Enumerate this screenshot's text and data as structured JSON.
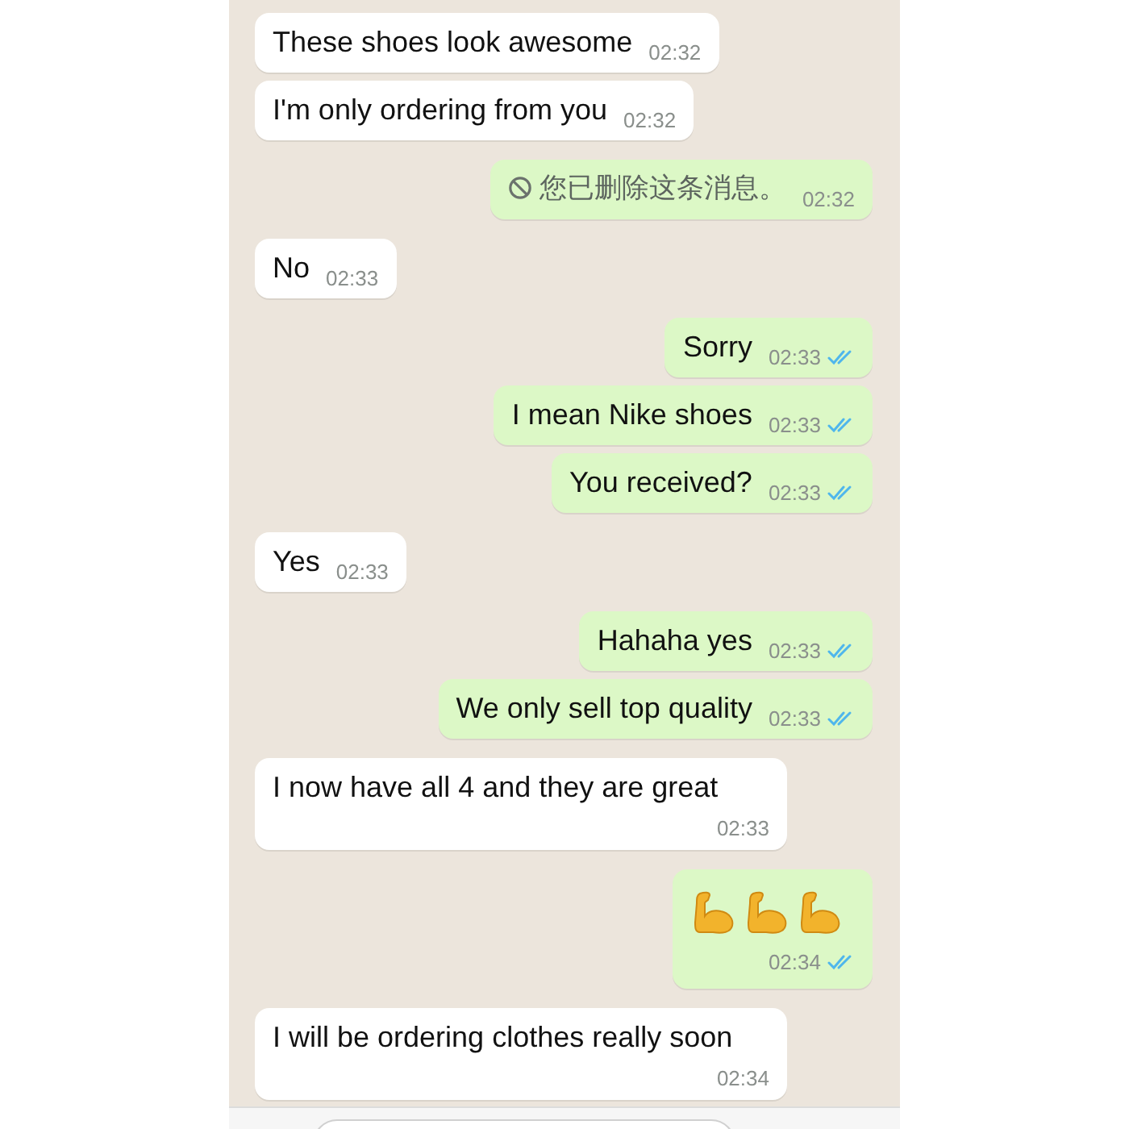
{
  "messages": [
    {
      "kind": "text",
      "outgoing": false,
      "text": "These shoes look awesome",
      "time": "02:32"
    },
    {
      "kind": "text",
      "outgoing": false,
      "text": "I'm only ordering from you",
      "time": "02:32"
    },
    {
      "kind": "deleted",
      "outgoing": true,
      "text": "您已删除这条消息。",
      "time": "02:32"
    },
    {
      "kind": "text",
      "outgoing": false,
      "text": "No",
      "time": "02:33"
    },
    {
      "kind": "text",
      "outgoing": true,
      "text": "Sorry",
      "time": "02:33",
      "read": true
    },
    {
      "kind": "text",
      "outgoing": true,
      "text": "I mean Nike shoes",
      "time": "02:33",
      "read": true
    },
    {
      "kind": "text",
      "outgoing": true,
      "text": "You received?",
      "time": "02:33",
      "read": true
    },
    {
      "kind": "text",
      "outgoing": false,
      "text": "Yes",
      "time": "02:33"
    },
    {
      "kind": "text",
      "outgoing": true,
      "text": "Hahaha yes",
      "time": "02:33",
      "read": true
    },
    {
      "kind": "text",
      "outgoing": true,
      "text": "We only sell top quality",
      "time": "02:33",
      "read": true
    },
    {
      "kind": "text",
      "outgoing": false,
      "text": "I now have all 4 and they are great",
      "time": "02:33"
    },
    {
      "kind": "flex_emoji",
      "outgoing": true,
      "time": "02:34",
      "read": true
    },
    {
      "kind": "text",
      "outgoing": false,
      "text": "I will be ordering clothes really soon",
      "time": "02:34"
    }
  ]
}
